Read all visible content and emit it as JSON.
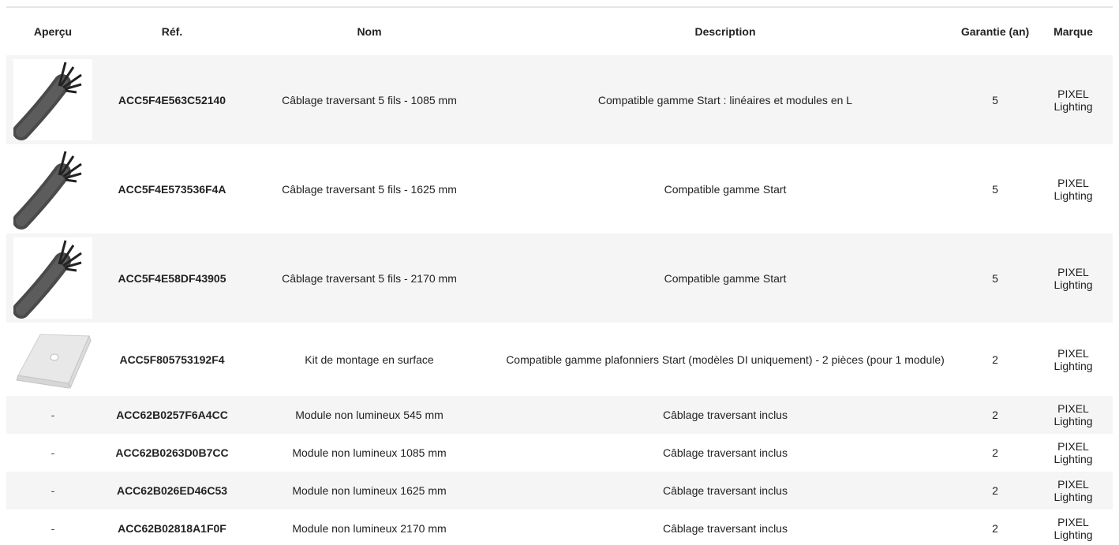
{
  "table": {
    "headers": {
      "preview": "Aperçu",
      "ref": "Réf.",
      "name": "Nom",
      "description": "Description",
      "warranty": "Garantie (an)",
      "brand": "Marque"
    },
    "rows": [
      {
        "preview_icon": "cable-icon",
        "ref": "ACC5F4E563C52140",
        "name": "Câblage traversant 5 fils - 1085 mm",
        "description": "Compatible gamme Start : linéaires et modules en L",
        "warranty": "5",
        "brand": "PIXEL Lighting"
      },
      {
        "preview_icon": "cable-icon",
        "ref": "ACC5F4E573536F4A",
        "name": "Câblage traversant 5 fils - 1625 mm",
        "description": "Compatible gamme Start",
        "warranty": "5",
        "brand": "PIXEL Lighting"
      },
      {
        "preview_icon": "cable-icon",
        "ref": "ACC5F4E58DF43905",
        "name": "Câblage traversant 5 fils - 2170 mm",
        "description": "Compatible gamme Start",
        "warranty": "5",
        "brand": "PIXEL Lighting"
      },
      {
        "preview_icon": "mounting-plate-icon",
        "ref": "ACC5F805753192F4",
        "name": "Kit de montage en surface",
        "description": "Compatible gamme plafonniers Start (modèles DI uniquement) - 2 pièces (pour 1 module)",
        "warranty": "2",
        "brand": "PIXEL Lighting"
      },
      {
        "preview": "-",
        "ref": "ACC62B0257F6A4CC",
        "name": "Module non lumineux 545 mm",
        "description": "Câblage traversant inclus",
        "warranty": "2",
        "brand": "PIXEL Lighting"
      },
      {
        "preview": "-",
        "ref": "ACC62B0263D0B7CC",
        "name": "Module non lumineux 1085 mm",
        "description": "Câblage traversant inclus",
        "warranty": "2",
        "brand": "PIXEL Lighting"
      },
      {
        "preview": "-",
        "ref": "ACC62B026ED46C53",
        "name": "Module non lumineux 1625 mm",
        "description": "Câblage traversant inclus",
        "warranty": "2",
        "brand": "PIXEL Lighting"
      },
      {
        "preview": "-",
        "ref": "ACC62B02818A1F0F",
        "name": "Module non lumineux 2170 mm",
        "description": "Câblage traversant inclus",
        "warranty": "2",
        "brand": "PIXEL Lighting"
      }
    ]
  }
}
